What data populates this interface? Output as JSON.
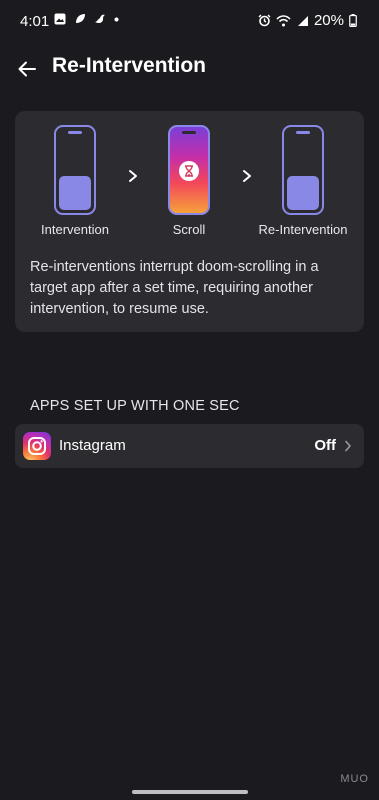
{
  "status_bar": {
    "time": "4:01",
    "battery": "20%",
    "icons_left": [
      "gallery-icon",
      "leaf-icon",
      "bird-icon",
      "dot-icon"
    ],
    "icons_right": [
      "alarm-icon",
      "wifi-icon",
      "signal-icon",
      "battery-icon"
    ]
  },
  "header": {
    "title": "Re-Intervention",
    "back_icon": "arrow-left-icon"
  },
  "info_card": {
    "steps": [
      {
        "label": "Intervention"
      },
      {
        "label": "Scroll"
      },
      {
        "label": "Re-Intervention"
      }
    ],
    "description": "Re-interventions interrupt doom-scrolling in a target app after a set time, requiring another intervention, to resume use.",
    "colors": {
      "accent": "#8a88e6",
      "card_bg": "#2c2b30"
    }
  },
  "section": {
    "header": "APPS SET UP WITH ONE SEC"
  },
  "apps": [
    {
      "name": "Instagram",
      "status": "Off",
      "icon": "instagram-icon"
    }
  ],
  "watermark": "MUO"
}
